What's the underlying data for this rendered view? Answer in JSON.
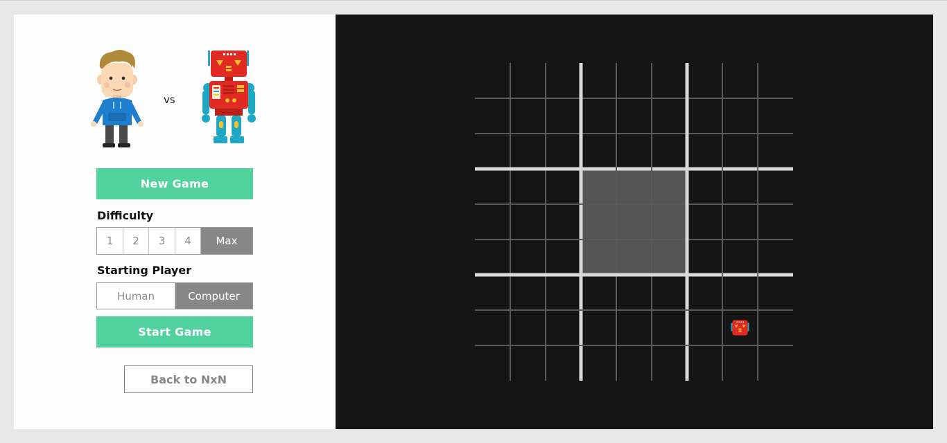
{
  "players": {
    "human_icon": "human-avatar-icon",
    "vs_label": "vs",
    "computer_icon": "robot-avatar-icon"
  },
  "controls": {
    "new_game_label": "New Game",
    "difficulty_label": "Difficulty",
    "difficulty_options": [
      "1",
      "2",
      "3",
      "4",
      "Max"
    ],
    "difficulty_selected": "Max",
    "starting_player_label": "Starting Player",
    "starting_player_options": [
      "Human",
      "Computer"
    ],
    "starting_player_selected": "Computer",
    "start_game_label": "Start Game",
    "back_label": "Back to NxN"
  },
  "board": {
    "size": 9,
    "subgrid": 3,
    "active_subgrid": {
      "row": 1,
      "col": 1
    },
    "moves": [
      {
        "row": 7,
        "col": 7,
        "player": "computer",
        "icon": "robot-piece-icon"
      }
    ]
  },
  "colors": {
    "accent_green": "#51d19b",
    "selected_gray": "#888888",
    "board_bg": "#151515",
    "active_cell": "#555555",
    "thin_line": "#5a5a5a",
    "thick_line": "#d9d9d9",
    "robot_red": "#e02a22",
    "robot_teal": "#1fa7c4",
    "human_blue": "#1f7fcf"
  }
}
